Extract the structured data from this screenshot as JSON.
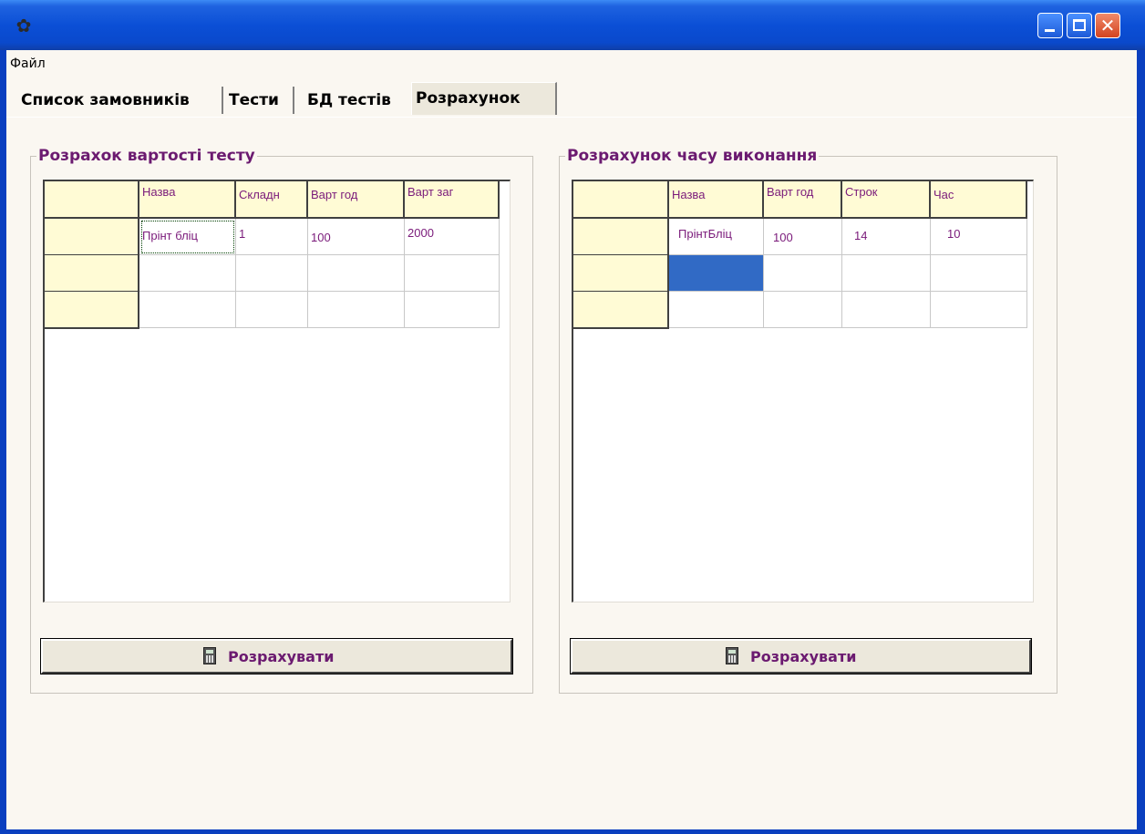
{
  "window": {
    "title": ""
  },
  "menu": {
    "file": "Файл"
  },
  "tabs": [
    {
      "label": "Список замовників"
    },
    {
      "label": "Тести"
    },
    {
      "label": "БД тестів"
    },
    {
      "label": "Розрахунок"
    }
  ],
  "active_tab": "Розрахунок",
  "cost_panel": {
    "title": "Розрахок вартості тесту",
    "columns": [
      "Назва",
      "Складн",
      "Варт год",
      "Варт заг"
    ],
    "rows": [
      [
        "Прінт бліц",
        "1",
        "100",
        "2000"
      ],
      [
        "",
        "",
        "",
        ""
      ],
      [
        "",
        "",
        "",
        ""
      ]
    ],
    "button_label": "Розрахувати"
  },
  "time_panel": {
    "title": "Розрахунок часу виконання",
    "columns": [
      "Назва",
      "Варт год",
      "Строк",
      "Час"
    ],
    "rows": [
      [
        "ПрінтБліц",
        "100",
        "14",
        "10"
      ],
      [
        "",
        "",
        "",
        ""
      ],
      [
        "",
        "",
        "",
        ""
      ]
    ],
    "button_label": "Розрахувати"
  },
  "colors": {
    "accent_text": "#6b1a70",
    "grid_fixed": "#fffbd5",
    "selection": "#316ac5"
  },
  "icons": [
    "app-icon",
    "minimize-icon",
    "maximize-icon",
    "close-icon",
    "calculator-icon"
  ]
}
